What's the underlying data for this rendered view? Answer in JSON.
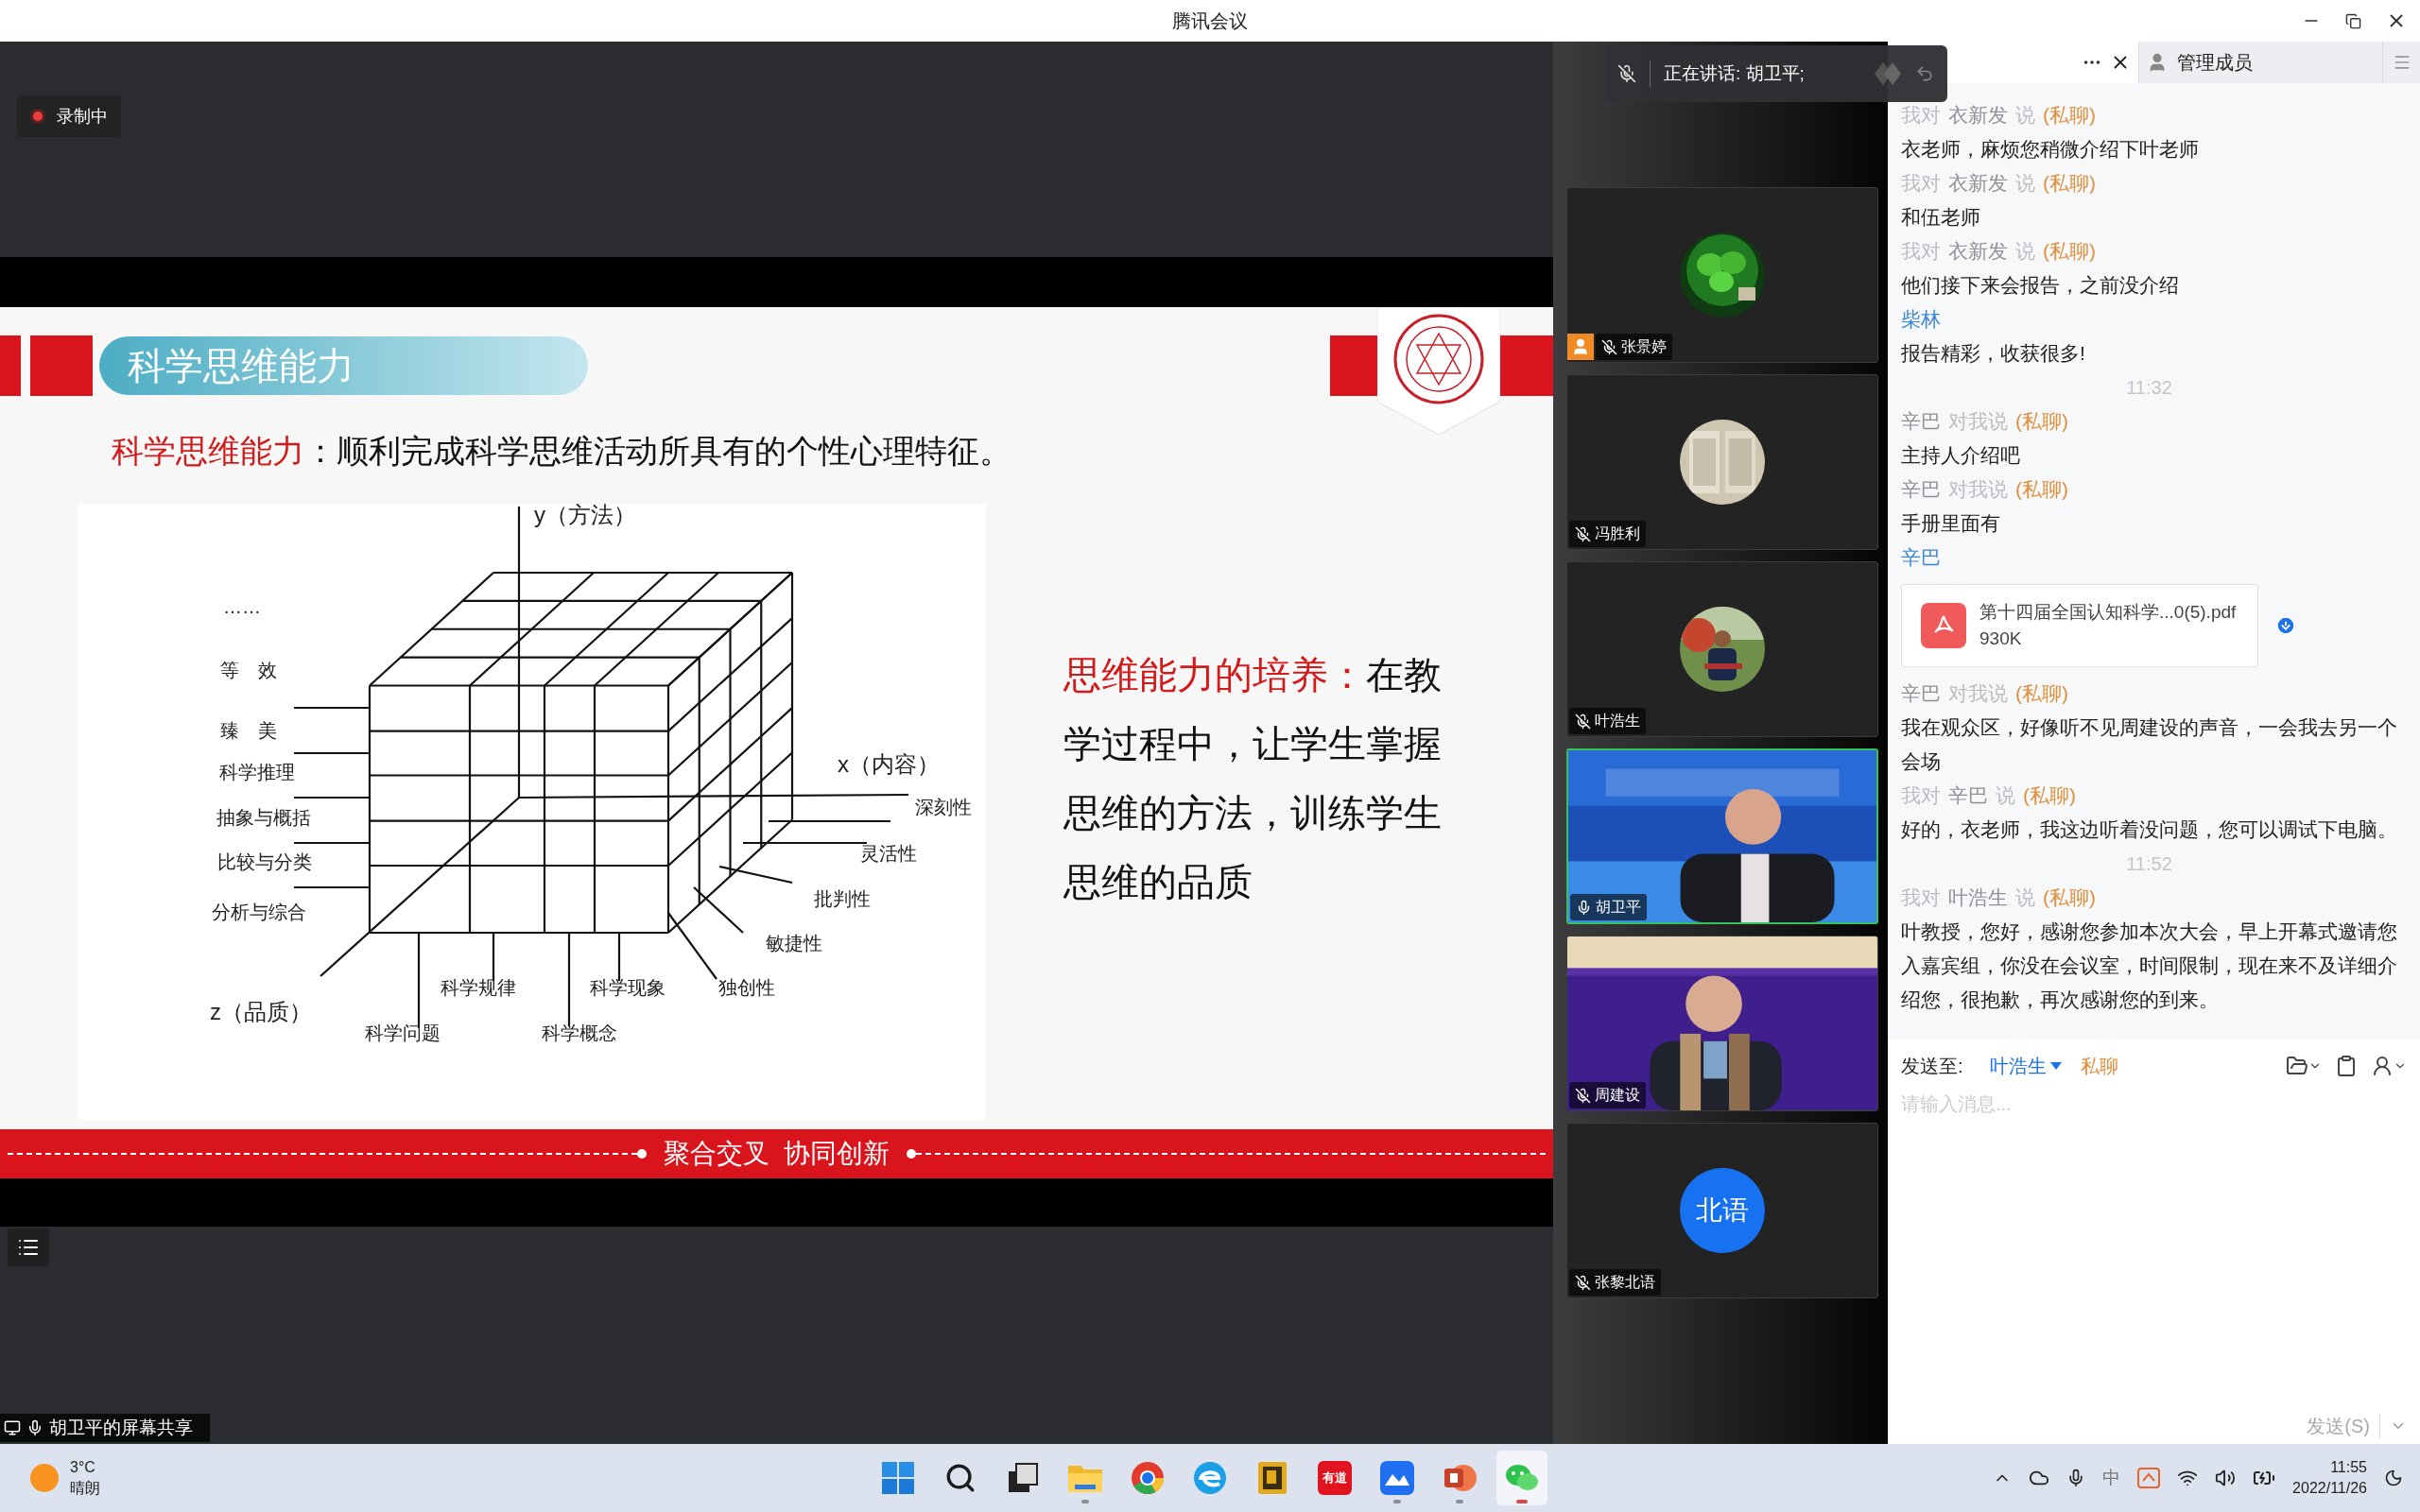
{
  "window": {
    "title": "腾讯会议"
  },
  "recording": {
    "label": "录制中"
  },
  "speaking": {
    "label": "正在讲话: 胡卫平;"
  },
  "slide": {
    "title": "科学思维能力",
    "definition": {
      "term": "科学思维能力",
      "text": "：顺利完成科学思维活动所具有的个性心理特征。"
    },
    "diagram": {
      "y_axis": "y（方法）",
      "x_axis": "x（内容）",
      "z_axis": "z（品质）",
      "methods": [
        "……",
        "等　效",
        "臻　美",
        "科学推理",
        "抽象与概括",
        "比较与分类",
        "分析与综合"
      ],
      "contents": [
        "科学问题",
        "科学规律",
        "科学概念",
        "科学现象"
      ],
      "qualities": [
        "独创性",
        "敏捷性",
        "批判性",
        "灵活性",
        "深刻性"
      ]
    },
    "cultivation": {
      "term": "思维能力的培养：",
      "text": "在教学过程中，让学生掌握思维的方法，训练学生思维的品质"
    },
    "banner": "聚合交叉  协同创新"
  },
  "share_label": "胡卫平的屏幕共享",
  "participants": [
    {
      "name": "张景婷",
      "kind": "picture",
      "muted": true,
      "speaking": false,
      "badge": true
    },
    {
      "name": "冯胜利",
      "kind": "picture",
      "muted": true,
      "speaking": false,
      "badge": false
    },
    {
      "name": "叶浩生",
      "kind": "picture",
      "muted": true,
      "speaking": false,
      "badge": false
    },
    {
      "name": "胡卫平",
      "kind": "video",
      "muted": false,
      "speaking": true,
      "badge": false
    },
    {
      "name": "周建设",
      "kind": "video",
      "muted": true,
      "speaking": false,
      "badge": false
    },
    {
      "name": "张黎北语",
      "kind": "initials",
      "initials": "北语",
      "muted": true,
      "speaking": false,
      "badge": false
    }
  ],
  "chat": {
    "tabs": [
      {
        "kind": "chat",
        "selected": true
      },
      {
        "kind": "members",
        "label": "管理成员",
        "selected": false
      }
    ],
    "messages": [
      {
        "kind": "header",
        "parts": [
          {
            "text": "我对",
            "color": "#b9bcc1"
          },
          {
            "text": "衣新发",
            "color": "#8e9196"
          },
          {
            "text": "说",
            "color": "#b9bcc1"
          }
        ],
        "tag": "(私聊)"
      },
      {
        "kind": "text",
        "text": "衣老师，麻烦您稍微介绍下叶老师"
      },
      {
        "kind": "header",
        "parts": [
          {
            "text": "我对",
            "color": "#b9bcc1"
          },
          {
            "text": "衣新发",
            "color": "#8e9196"
          },
          {
            "text": "说",
            "color": "#b9bcc1"
          }
        ],
        "tag": "(私聊)"
      },
      {
        "kind": "text",
        "text": "和伍老师"
      },
      {
        "kind": "header",
        "parts": [
          {
            "text": "我对",
            "color": "#b9bcc1"
          },
          {
            "text": "衣新发",
            "color": "#8e9196"
          },
          {
            "text": "说",
            "color": "#b9bcc1"
          }
        ],
        "tag": "(私聊)"
      },
      {
        "kind": "text",
        "text": "他们接下来会报告，之前没介绍"
      },
      {
        "kind": "sender",
        "text": "柴林"
      },
      {
        "kind": "text",
        "text": "报告精彩，收获很多!"
      },
      {
        "kind": "time",
        "text": "11:32"
      },
      {
        "kind": "header",
        "parts": [
          {
            "text": "辛巴",
            "color": "#8e9196"
          },
          {
            "text": "对我说",
            "color": "#b9bcc1"
          }
        ],
        "tag": "(私聊)"
      },
      {
        "kind": "text",
        "text": "主持人介绍吧"
      },
      {
        "kind": "header",
        "parts": [
          {
            "text": "辛巴",
            "color": "#8e9196"
          },
          {
            "text": "对我说",
            "color": "#b9bcc1"
          }
        ],
        "tag": "(私聊)"
      },
      {
        "kind": "text",
        "text": "手册里面有"
      },
      {
        "kind": "sender",
        "text": "辛巴"
      },
      {
        "kind": "file",
        "name": "第十四届全国认知科学...0(5).pdf",
        "size": "930K"
      },
      {
        "kind": "header",
        "parts": [
          {
            "text": "辛巴",
            "color": "#8e9196"
          },
          {
            "text": "对我说",
            "color": "#b9bcc1"
          }
        ],
        "tag": "(私聊)"
      },
      {
        "kind": "text",
        "text": "我在观众区，好像听不见周建设的声音，一会我去另一个会场"
      },
      {
        "kind": "header",
        "parts": [
          {
            "text": "我对",
            "color": "#b9bcc1"
          },
          {
            "text": "辛巴",
            "color": "#8e9196"
          },
          {
            "text": "说",
            "color": "#b9bcc1"
          }
        ],
        "tag": "(私聊)"
      },
      {
        "kind": "text",
        "text": "好的，衣老师，我这边听着没问题，您可以调试下电脑。"
      },
      {
        "kind": "time",
        "text": "11:52"
      },
      {
        "kind": "header",
        "parts": [
          {
            "text": "我对",
            "color": "#b9bcc1"
          },
          {
            "text": "叶浩生",
            "color": "#8e9196"
          },
          {
            "text": "说",
            "color": "#b9bcc1"
          }
        ],
        "tag": "(私聊)"
      },
      {
        "kind": "text",
        "text": "叶教授，您好，感谢您参加本次大会，早上开幕式邀请您入嘉宾组，你没在会议室，时间限制，现在来不及详细介绍您，很抱歉，再次感谢您的到来。"
      }
    ],
    "compose": {
      "label": "发送至:",
      "recipient": "叶浩生",
      "mode": "私聊",
      "placeholder": "请输入消息...",
      "send": "发送(S)"
    }
  },
  "taskbar": {
    "weather": {
      "temp": "3°C",
      "condition": "晴朗"
    },
    "apps": [
      {
        "kind": "start",
        "running": false,
        "selected": false
      },
      {
        "kind": "search",
        "running": false,
        "selected": false
      },
      {
        "kind": "taskview",
        "running": false,
        "selected": false
      },
      {
        "kind": "explorer",
        "running": true,
        "selected": false
      },
      {
        "kind": "chrome",
        "running": false,
        "selected": false
      },
      {
        "kind": "edge",
        "running": false,
        "selected": false
      },
      {
        "kind": "notes",
        "running": false,
        "selected": false
      },
      {
        "kind": "youdao",
        "label": "有道",
        "running": false,
        "selected": false
      },
      {
        "kind": "feishu",
        "running": true,
        "selected": false
      },
      {
        "kind": "powerpoint",
        "running": true,
        "selected": false
      },
      {
        "kind": "wechat",
        "running": true,
        "selected": true
      }
    ],
    "ime": "中",
    "time": "11:55",
    "date": "2022/11/26"
  }
}
